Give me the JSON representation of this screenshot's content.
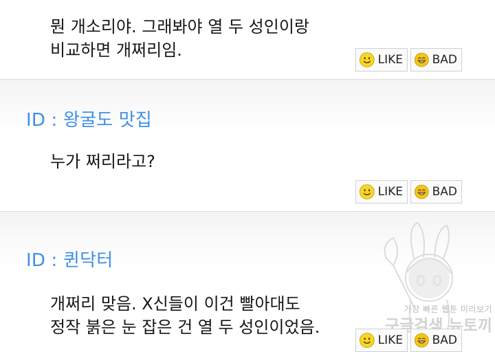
{
  "comments": [
    {
      "id": "",
      "lines": [
        "뭔 개소리야. 그래봐야 열 두 성인이랑",
        "비교하면 개쩌리임."
      ],
      "like_label": "LIKE",
      "bad_label": "BAD"
    },
    {
      "id": "ID : 왕굴도 맛집",
      "lines": [
        "누가 쩌리라고?"
      ],
      "like_label": "LIKE",
      "bad_label": "BAD"
    },
    {
      "id": "ID : 퀸닥터",
      "lines": [
        "개쩌리 맞음. X신들이 이건 빨아대도",
        "정작 붉은 눈 잡은 건 열 두 성인이었음."
      ],
      "like_label": "LIKE",
      "bad_label": "BAD"
    }
  ],
  "watermark": {
    "line1": "가장 빠른 웹툰 미리보기",
    "line2": "구글검색 뉴토끼"
  },
  "colors": {
    "author": "#3f8fe8",
    "like_face": "#f7d629",
    "bad_face": "#f3c51c"
  },
  "icons": {
    "like": "smiley-face-icon",
    "bad": "grinning-face-icon"
  }
}
